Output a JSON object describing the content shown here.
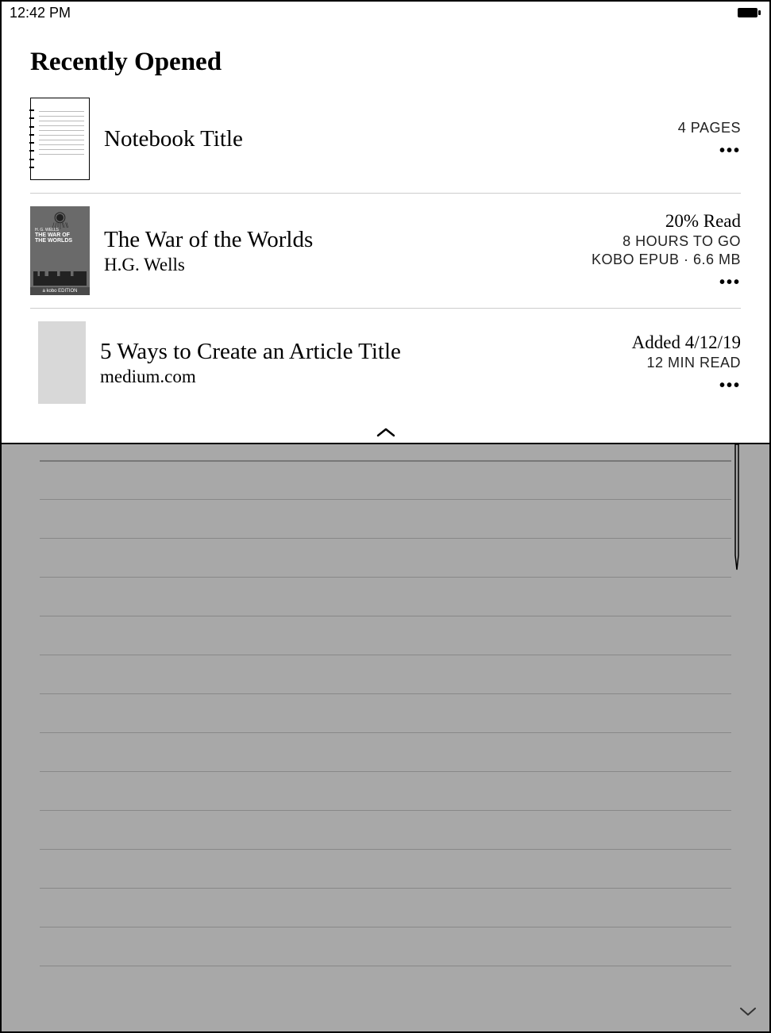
{
  "statusbar": {
    "time": "12:42 PM"
  },
  "section_title": "Recently Opened",
  "items": [
    {
      "title": "Notebook Title",
      "subtitle": "",
      "meta_pages": "4 PAGES"
    },
    {
      "title": "The War of the Worlds",
      "subtitle": "H.G. Wells",
      "meta_progress": "20% Read",
      "meta_timeleft": "8 HOURS TO GO",
      "meta_format": "KOBO EPUB · 6.6 MB"
    },
    {
      "title": "5 Ways to Create an Article Title",
      "subtitle": "medium.com",
      "meta_added": "Added 4/12/19",
      "meta_readtime": "12 MIN READ"
    }
  ],
  "book_cover": {
    "author_small": "H. G. WELLS",
    "title_line1": "THE WAR OF",
    "title_line2": "THE WORLDS",
    "edition": "a kobo EDITION"
  }
}
